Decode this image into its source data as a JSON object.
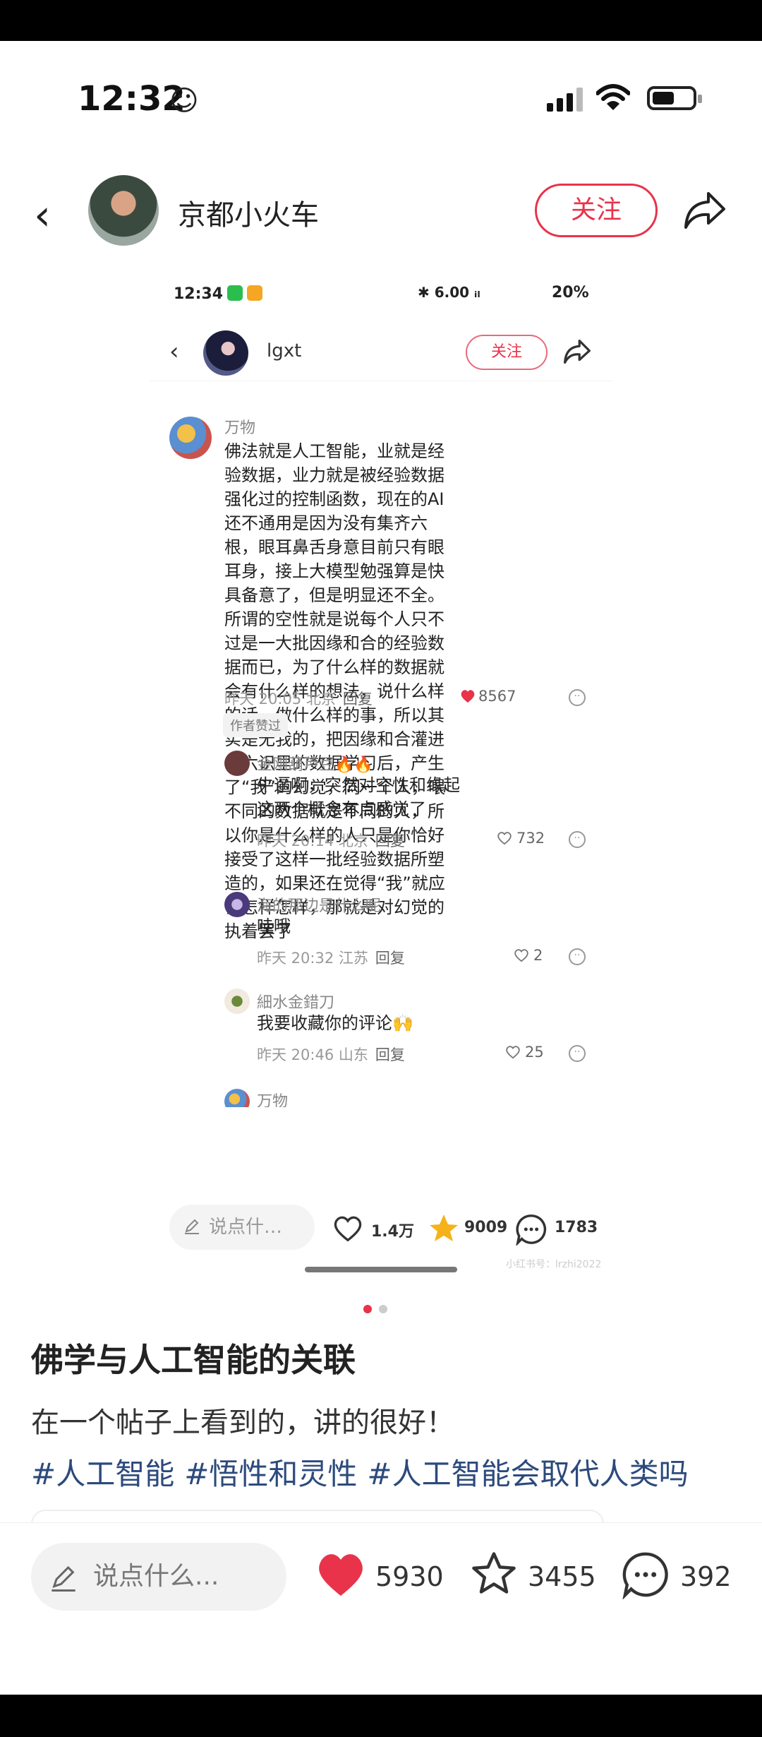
{
  "status_bar": {
    "time": "12:32",
    "emoji": "☺"
  },
  "header": {
    "username": "京都小火车",
    "follow_label": "关注"
  },
  "inner_screenshot": {
    "status_time": "12:34",
    "status_right": "✱ 6.00 ᵢₗ",
    "battery": "20%",
    "username": "lgxt",
    "follow_label": "关注",
    "comments": [
      {
        "author": "万物",
        "text": "佛法就是人工智能，业就是经验数据，业力就是被经验数据强化过的控制函数，现在的AI还不通用是因为没有集齐六根，眼耳鼻舌身意目前只有眼耳身，接上大模型勉强算是快具备意了，但是明显还不全。所谓的空性就是说每个人只不过是一大批因缘和合的经验数据而已，为了什么样的数据就会有什么样的想法，说什么样的话，做什么样的事，所以其实是无我的，把因缘和合灌进你六识里的数据学习后，产生了“我”的幻觉，同一个人，喂不同的数据就是不同的人，所以你是什么样的人只是你恰好接受了这样一批经验数据所塑造的，如果还在觉得“我”就应该怎样怎样，那就是对幻觉的执着罢了",
        "time": "昨天 20:05 北京",
        "reply": "回复",
        "likes": "8567",
        "badge": "作者赞过"
      },
      {
        "author": "金刚葫芦豆🔥🔥",
        "text": "牛逼啊，突然对空性和缘起这两个概念有点感觉了",
        "time": "昨天 20:14 北京",
        "reply": "回复",
        "likes": "732"
      },
      {
        "author": "海的那边是什么呢",
        "text": "哇哦",
        "time": "昨天 20:32 江苏",
        "reply": "回复",
        "likes": "2"
      },
      {
        "author": "細水金錯刀",
        "text": "我要收藏你的评论🙌",
        "time": "昨天 20:46 山东",
        "reply": "回复",
        "likes": "25"
      },
      {
        "author": "万物"
      }
    ],
    "input_placeholder": "说点什…",
    "likes": "1.4万",
    "stars": "9009",
    "comments_count": "1783",
    "watermark": "小红书号：lrzhi2022"
  },
  "post": {
    "title": "佛学与人工智能的关联",
    "description": "在一个帖子上看到的，讲的很好！",
    "tags": [
      "#人工智能",
      "#悟性和灵性",
      "#人工智能会取代人类吗"
    ]
  },
  "bottom_bar": {
    "input_placeholder": "说点什么...",
    "likes": "5930",
    "stars": "3455",
    "comments": "392"
  },
  "colors": {
    "accent": "#e8334b",
    "tag": "#2c4a7c",
    "star": "#f5b21a"
  }
}
